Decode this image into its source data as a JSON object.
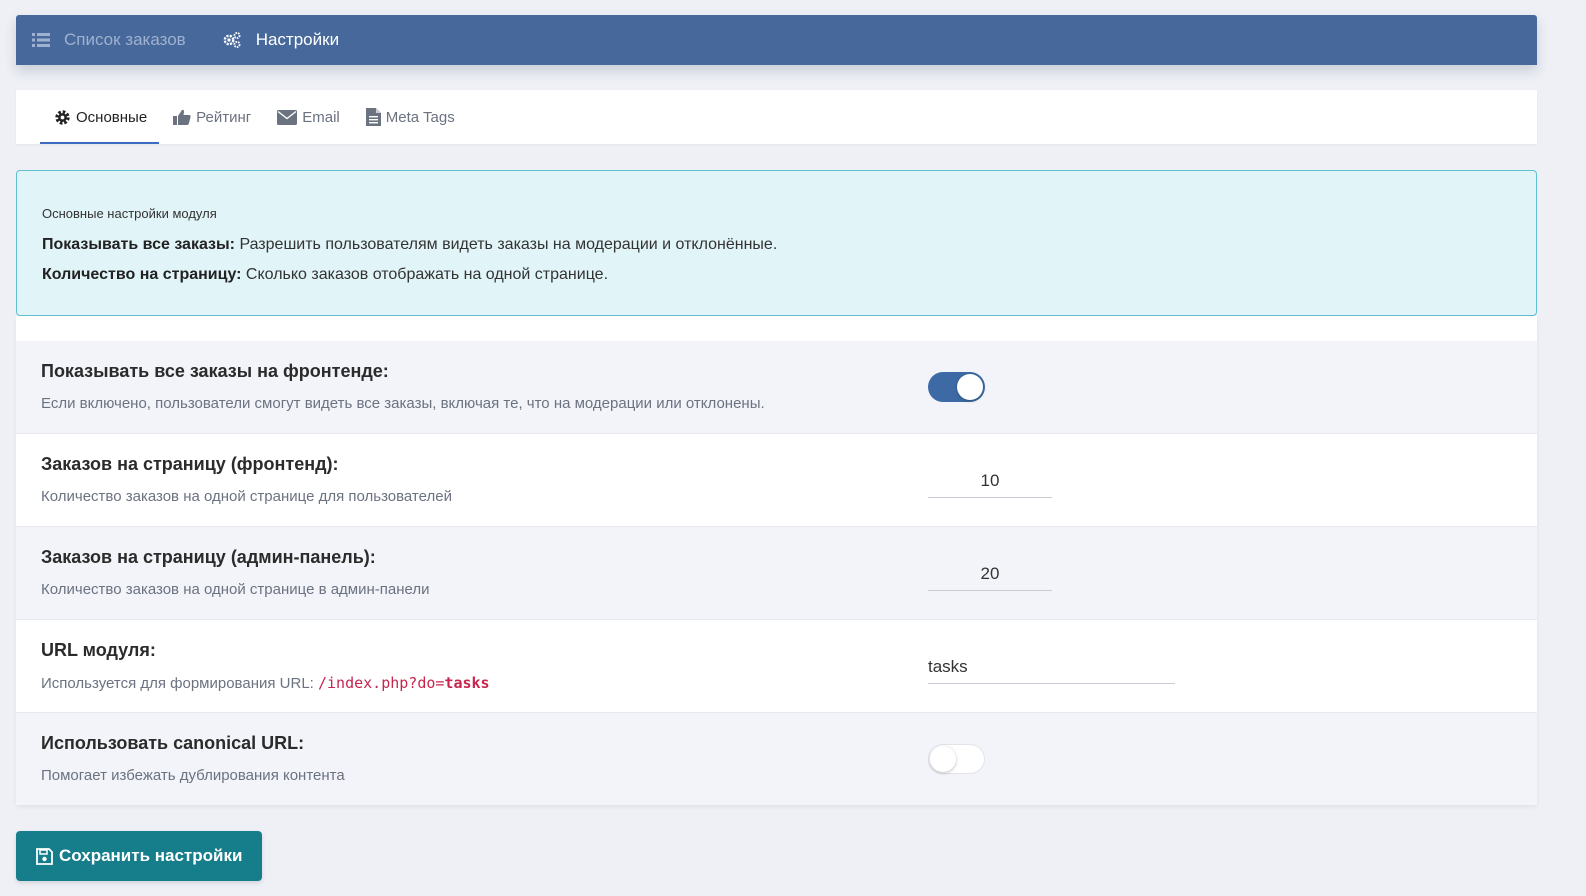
{
  "topbar": {
    "items": [
      {
        "label": "Список заказов",
        "icon": "list-icon",
        "active": false
      },
      {
        "label": "Настройки",
        "icon": "gears-icon",
        "active": true
      }
    ]
  },
  "tabs": [
    {
      "label": "Основные",
      "icon": "gear-icon",
      "active": true
    },
    {
      "label": "Рейтинг",
      "icon": "thumbs-up-icon",
      "active": false
    },
    {
      "label": "Email",
      "icon": "envelope-icon",
      "active": false
    },
    {
      "label": "Meta Tags",
      "icon": "document-icon",
      "active": false
    }
  ],
  "info": {
    "title": "Основные настройки модуля",
    "lines": [
      {
        "bold": "Показывать все заказы:",
        "text": " Разрешить пользователям видеть заказы на модерации и отклонённые."
      },
      {
        "bold": "Количество на страницу:",
        "text": " Сколько заказов отображать на одной странице."
      }
    ]
  },
  "settings": {
    "show_all": {
      "label": "Показывать все заказы на фронтенде:",
      "desc": "Если включено, пользователи смогут видеть все заказы, включая те, что на модерации или отклонены.",
      "enabled": true
    },
    "per_page_front": {
      "label": "Заказов на страницу (фронтенд):",
      "desc": "Количество заказов на одной странице для пользователей",
      "value": "10"
    },
    "per_page_admin": {
      "label": "Заказов на страницу (админ-панель):",
      "desc": "Количество заказов на одной странице в админ-панели",
      "value": "20"
    },
    "module_url": {
      "label": "URL модуля:",
      "desc": "Используется для формирования URL: ",
      "code_prefix": "/index.php?do=",
      "code_value": "tasks",
      "value": "tasks"
    },
    "canonical": {
      "label": "Использовать canonical URL:",
      "desc": "Помогает избежать дублирования контента",
      "enabled": false
    }
  },
  "save_button": {
    "label": "Сохранить настройки",
    "icon": "floppy-disk-icon"
  },
  "colors": {
    "topbar": "#46689a",
    "accent": "#3d6aa5",
    "info_bg": "#e1f4f8",
    "info_border": "#5ec0d2",
    "save_button": "#167e8a",
    "code": "#c7254e"
  }
}
